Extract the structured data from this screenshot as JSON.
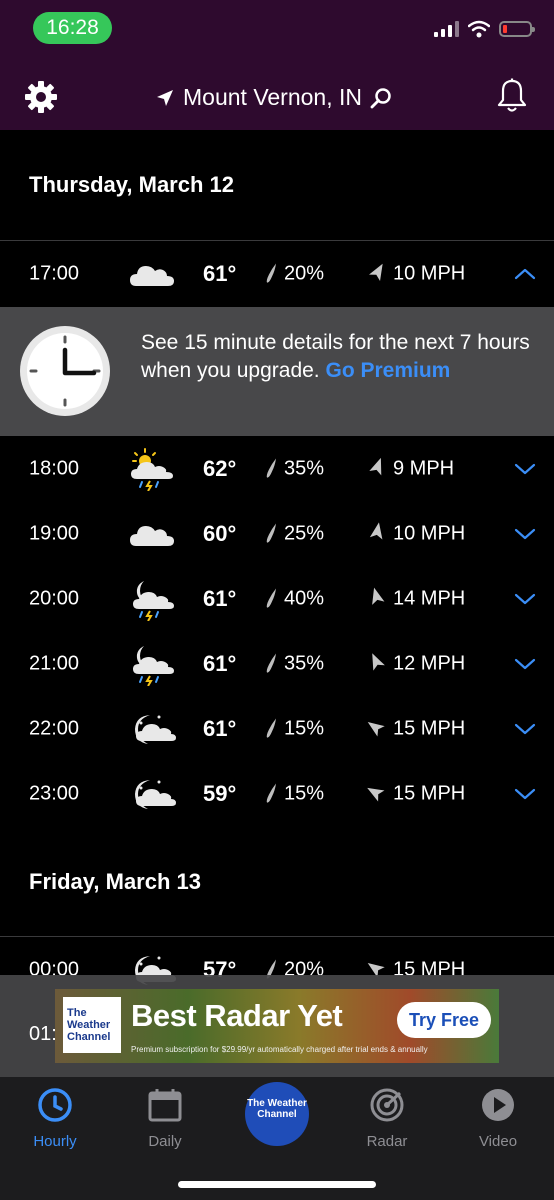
{
  "status": {
    "time": "16:28"
  },
  "header": {
    "location": "Mount Vernon, IN"
  },
  "days": [
    {
      "label": "Thursday, March 12"
    },
    {
      "label": "Friday, March 13"
    }
  ],
  "rows": [
    {
      "time": "17:00",
      "icon": "cloud-icon",
      "temp": "61°",
      "precip": "20%",
      "wind": "10 MPH",
      "expanded": true
    },
    {
      "time": "18:00",
      "icon": "partly-sunny-thunderstorm-icon",
      "temp": "62°",
      "precip": "35%",
      "wind": "9 MPH"
    },
    {
      "time": "19:00",
      "icon": "cloud-icon",
      "temp": "60°",
      "precip": "25%",
      "wind": "10 MPH"
    },
    {
      "time": "20:00",
      "icon": "night-thunderstorm-icon",
      "temp": "61°",
      "precip": "40%",
      "wind": "14 MPH"
    },
    {
      "time": "21:00",
      "icon": "night-thunderstorm-icon",
      "temp": "61°",
      "precip": "35%",
      "wind": "12 MPH"
    },
    {
      "time": "22:00",
      "icon": "partly-cloudy-night-icon",
      "temp": "61°",
      "precip": "15%",
      "wind": "15 MPH"
    },
    {
      "time": "23:00",
      "icon": "partly-cloudy-night-icon",
      "temp": "59°",
      "precip": "15%",
      "wind": "15 MPH"
    },
    {
      "time": "00:00",
      "icon": "partly-cloudy-night-icon",
      "temp": "57°",
      "precip": "20%",
      "wind": "15 MPH"
    },
    {
      "time": "01:"
    }
  ],
  "upgrade": {
    "text": "See 15 minute details for the next 7 hours when you upgrade.",
    "link": "Go Premium"
  },
  "ad": {
    "logo": "The Weather Channel",
    "title": "Best Radar Yet",
    "cta": "Try Free",
    "fine_print": "Premium subscription for $29.99/yr automatically charged after trial ends & annually"
  },
  "tabs": [
    {
      "label": "Hourly",
      "active": true
    },
    {
      "label": "Daily"
    },
    {
      "label": "The Weather Channel"
    },
    {
      "label": "Radar"
    },
    {
      "label": "Video"
    }
  ],
  "colors": {
    "header_bg": "#2e0a2e",
    "accent": "#3b8ef7",
    "status_time_bg": "#36c75a",
    "banner_bg": "#48484a",
    "tabbar_bg": "#1c1c1e",
    "twc_blue": "#1f4db8"
  }
}
